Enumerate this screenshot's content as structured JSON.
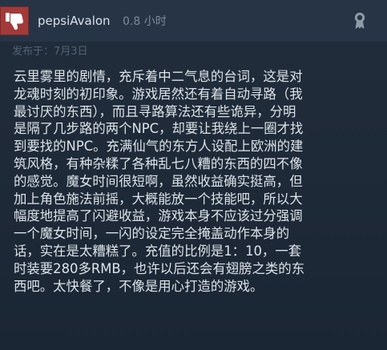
{
  "review": {
    "username": "pepsiAvalon",
    "hours": "0.8 小时",
    "posted": "发布于：7月3日",
    "recommendation": "not-recommended",
    "text_lines": [
      "云里雾里的剧情，充斥着中二气息的台词，这是对",
      "龙魂时刻的初印象。游戏居然还有着自动寻路（我",
      "最讨厌的东西），而且寻路算法还有些诡异，分明",
      "是隔了几步路的两个NPC，却要让我绕上一圈才找",
      "到要找的NPC。充满仙气的东方人设配上欧洲的建",
      "筑风格，有种杂糅了各种乱七八糟的东西的四不像",
      "的感觉。魔女时间很短啊，虽然收益确实挺高，但",
      "加上角色施法前摇，大概能放一个技能吧，所以大",
      "幅度地提高了闪避收益，游戏本身不应该过分强调",
      "一个魔女时间，一闪的设定完全掩盖动作本身的",
      "话，实在是太糟糕了。充值的比例是1：10，一套",
      "时装要280多RMB，也许以后还会有翅膀之类的东",
      "西吧。太快餐了，不像是用心打造的游戏。"
    ]
  },
  "colors": {
    "thumb_bg": "#a33a3a",
    "header_bg": "#273446",
    "body_bg": "#1f2a38",
    "text": "#dce3ea"
  },
  "icons": {
    "recommend": "thumbs-down-icon",
    "award": "award-icon"
  }
}
